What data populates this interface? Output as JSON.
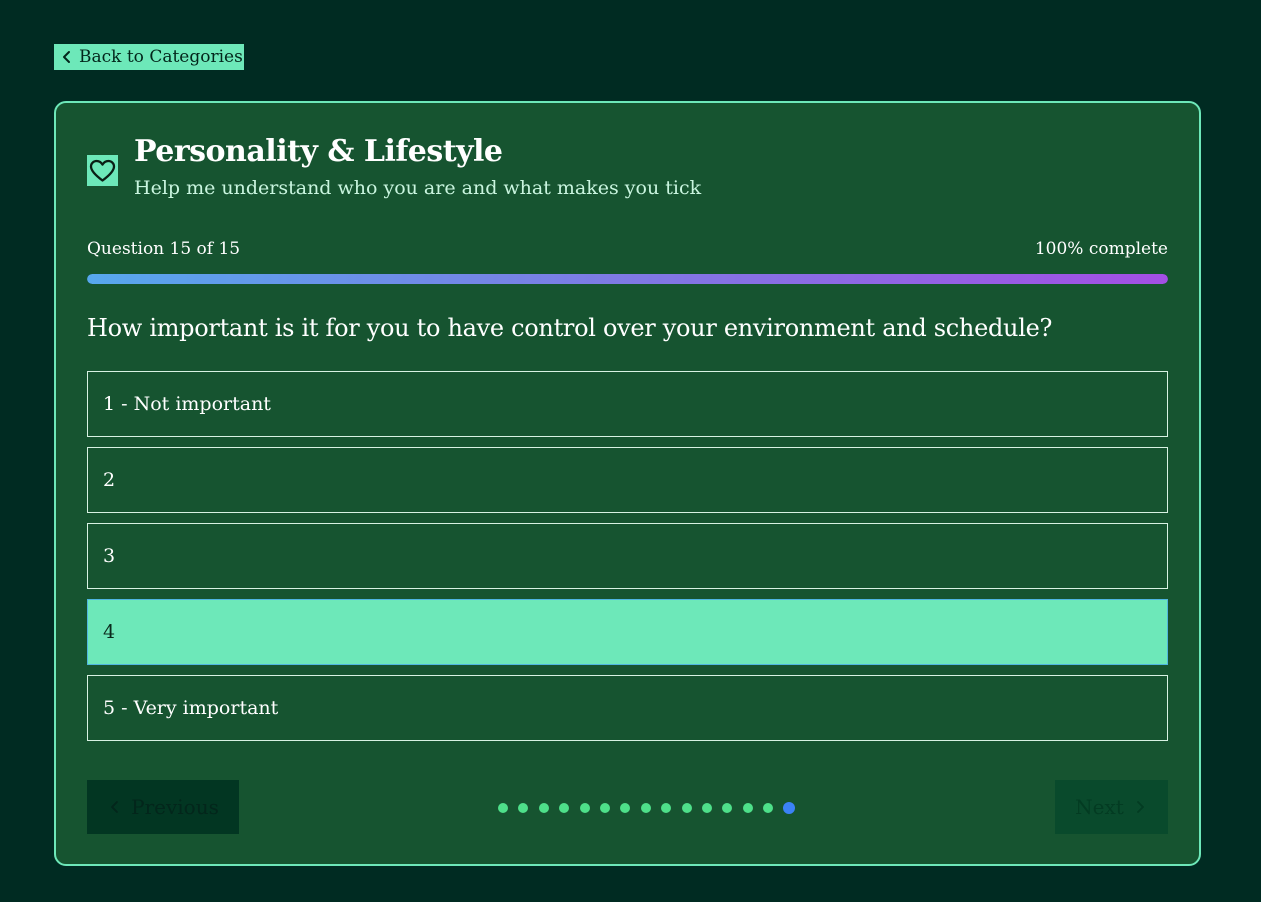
{
  "nav": {
    "back_label": "Back to Categories"
  },
  "category": {
    "icon": "heart-icon",
    "title": "Personality & Lifestyle",
    "subtitle": "Help me understand who you are and what makes you tick"
  },
  "progress": {
    "label": "Question 15 of 15",
    "percent_text": "100% complete",
    "fraction": 1.0,
    "current_question": 15,
    "total_questions": 15
  },
  "question": {
    "text": "How important is it for you to have control over your environment and schedule?",
    "options": [
      {
        "label": "1 - Not important",
        "selected": false
      },
      {
        "label": "2",
        "selected": false
      },
      {
        "label": "3",
        "selected": false
      },
      {
        "label": "4",
        "selected": true
      },
      {
        "label": "5 - Very important",
        "selected": false
      }
    ]
  },
  "buttons": {
    "previous_label": "Previous",
    "next_label": "Next"
  },
  "colors": {
    "page_background": "#002b22",
    "card_background": "#165430",
    "accent": "#6de8b9",
    "progress_gradient_start": "#57a8ed",
    "progress_gradient_end": "#a34fe4",
    "dot_answered": "#4ee08a",
    "dot_current": "#3b82f6"
  }
}
